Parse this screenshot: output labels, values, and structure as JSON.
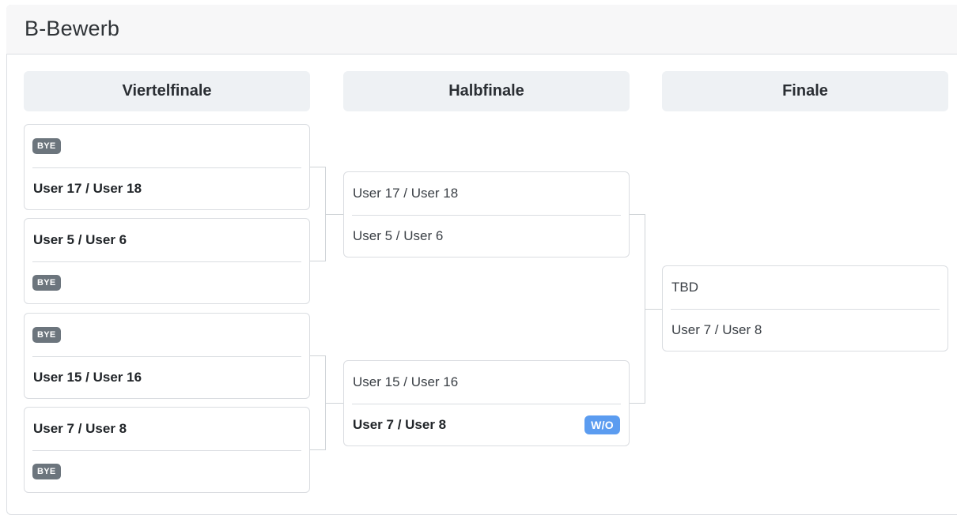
{
  "card": {
    "title": "B-Bewerb"
  },
  "rounds": [
    {
      "label": "Viertelfinale"
    },
    {
      "label": "Halbfinale"
    },
    {
      "label": "Finale"
    }
  ],
  "quarterfinals": [
    {
      "top": {
        "badge": "BYE"
      },
      "bottom": {
        "name": "User 17 / User 18",
        "winner": true
      }
    },
    {
      "top": {
        "name": "User 5 / User 6",
        "winner": true
      },
      "bottom": {
        "badge": "BYE"
      }
    },
    {
      "top": {
        "badge": "BYE"
      },
      "bottom": {
        "name": "User 15 / User 16",
        "winner": true
      }
    },
    {
      "top": {
        "name": "User 7 / User 8",
        "winner": true
      },
      "bottom": {
        "badge": "BYE"
      }
    }
  ],
  "semifinals": [
    {
      "top": {
        "name": "User 17 / User 18"
      },
      "bottom": {
        "name": "User 5 / User 6"
      }
    },
    {
      "top": {
        "name": "User 15 / User 16"
      },
      "bottom": {
        "name": "User 7 / User 8",
        "winner": true,
        "badge": "W/O"
      }
    }
  ],
  "final": {
    "top": {
      "name": "TBD"
    },
    "bottom": {
      "name": "User 7 / User 8"
    }
  },
  "colors": {
    "bye_badge": "#6c757d",
    "wo_badge": "#5b9cf0",
    "round_header_bg": "#eef1f4"
  }
}
